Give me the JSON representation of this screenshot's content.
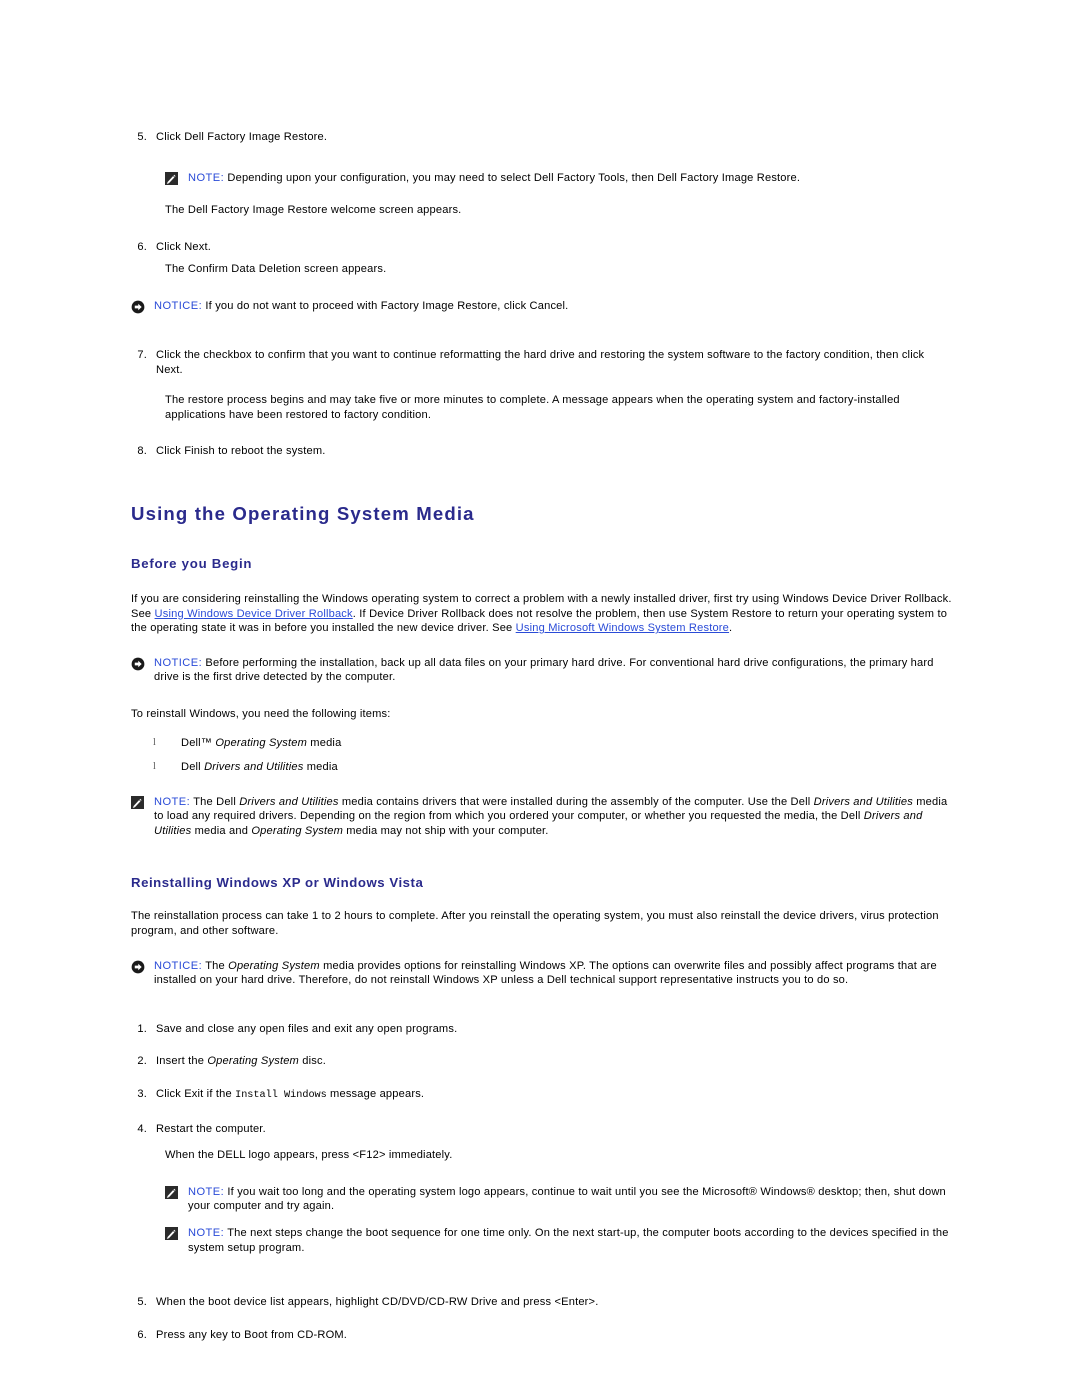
{
  "colors": {
    "heading": "#2a2a8c",
    "link": "#2a4bd7",
    "callout_label": "#2a4bd7",
    "body": "#000000",
    "background": "#ffffff"
  },
  "steps_top": [
    {
      "num": "5.",
      "text": "Click Dell Factory Image Restore."
    },
    {
      "num": "6.",
      "text": "Click Next."
    }
  ],
  "note_1": {
    "icon": "note-pencil-icon",
    "label": "NOTE:",
    "text": " Depending upon your configuration, you may need to select Dell Factory Tools, then Dell Factory Image Restore."
  },
  "para_welcome": "The Dell Factory Image Restore welcome screen appears.",
  "para_confirm": "The Confirm Data Deletion screen appears.",
  "notice_1": {
    "icon": "notice-arrow-icon",
    "label": "NOTICE:",
    "text": " If you do not want to proceed with Factory Image Restore, click Cancel."
  },
  "step_7": {
    "num": "7.",
    "text": "Click the checkbox to confirm that you want to continue reformatting the hard drive and restoring the system software to the factory condition, then click Next."
  },
  "para_restore": "The restore process begins and may take five or more minutes to complete. A message appears when the operating system and factory-installed applications have been restored to factory condition.",
  "step_8": {
    "num": "8.",
    "text": "Click Finish to reboot the system."
  },
  "section_media": {
    "title": "Using the Operating System Media",
    "sub_before": "Before you Begin",
    "para_before_1": "If you are considering reinstalling the Windows operating system to correct a problem with a newly installed driver, first try using Windows Device Driver Rollback. See ",
    "link_1": "Using Windows Device Driver Rollback",
    "para_before_2": ". If Device Driver Rollback does not resolve the problem, then use System Restore to return your operating system to the operating state it was in before you installed the new device driver. See ",
    "link_2": "Using Microsoft Windows System Restore",
    "para_before_3": ".",
    "notice_backup": {
      "icon": "notice-arrow-icon",
      "label": "NOTICE:",
      "text": " Before performing the installation, back up all data files on your primary hard drive. For conventional hard drive configurations, the primary hard drive is the first drive detected by the computer."
    },
    "para_items_intro": "To reinstall Windows, you need the following items:",
    "bullets": [
      {
        "mark": "l",
        "pre": "Dell™ ",
        "italic": "Operating System",
        "post": " media"
      },
      {
        "mark": "l",
        "pre": "Dell ",
        "italic": "Drivers and Utilities",
        "post": " media"
      }
    ],
    "note_drivers": {
      "icon": "note-pencil-icon",
      "label": "NOTE:",
      "seg1": " The Dell ",
      "it1": "Drivers and Utilities",
      "seg2": " media contains drivers that were installed during the assembly of the computer. Use the Dell ",
      "it2": "Drivers and Utilities",
      "seg3": " media to load any required drivers. Depending on the region from which you ordered your computer, or whether you requested the media, the Dell ",
      "it3": "Drivers and Utilities",
      "seg4": " media and ",
      "it4": "Operating System",
      "seg5": " media may not ship with your computer."
    }
  },
  "section_reinstall": {
    "title": "Reinstalling Windows XP or Windows Vista",
    "para_intro": "The reinstallation process can take 1 to 2 hours to complete. After you reinstall the operating system, you must also reinstall the device drivers, virus protection program, and other software.",
    "notice_os": {
      "icon": "notice-arrow-icon",
      "label": "NOTICE:",
      "seg1": " The ",
      "it1": "Operating System",
      "seg2": " media provides options for reinstalling Windows XP. The options can overwrite files and possibly affect programs that are installed on your hard drive. Therefore, do not reinstall Windows XP unless a Dell technical support representative instructs you to do so."
    },
    "steps": [
      {
        "num": "1.",
        "text": "Save and close any open files and exit any open programs."
      },
      {
        "num": "2.",
        "pre": "Insert the ",
        "italic": "Operating System",
        "post": " disc."
      },
      {
        "num": "3.",
        "pre": "Click Exit if the ",
        "mono": "Install Windows",
        "post": " message appears."
      },
      {
        "num": "4.",
        "text": "Restart the computer."
      }
    ],
    "para_f12": "When the DELL logo appears, press <F12> immediately.",
    "note_wait": {
      "icon": "note-pencil-icon",
      "label": "NOTE:",
      "text": " If you wait too long and the operating system logo appears, continue to wait until you see the Microsoft® Windows® desktop; then, shut down your computer and try again."
    },
    "note_boot": {
      "icon": "note-pencil-icon",
      "label": "NOTE:",
      "text": " The next steps change the boot sequence for one time only. On the next start-up, the computer boots according to the devices specified in the system setup program."
    },
    "steps_tail": [
      {
        "num": "5.",
        "text": "When the boot device list appears, highlight CD/DVD/CD-RW Drive and press <Enter>."
      },
      {
        "num": "6.",
        "text": "Press any key to Boot from CD-ROM."
      }
    ]
  }
}
